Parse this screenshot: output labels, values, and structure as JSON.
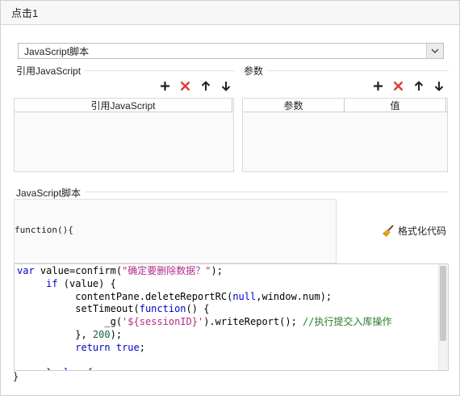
{
  "window": {
    "title": "点击1"
  },
  "script_type_select": {
    "selected": "JavaScript脚本"
  },
  "imports_section": {
    "label": "引用JavaScript",
    "column_header": "引用JavaScript",
    "toolbar": {
      "add": "add-icon",
      "delete": "delete-icon",
      "up": "arrow-up-icon",
      "down": "arrow-down-icon"
    },
    "rows": []
  },
  "params_section": {
    "label": "参数",
    "columns": [
      "参数",
      "值"
    ],
    "toolbar": {
      "add": "add-icon",
      "delete": "delete-icon",
      "up": "arrow-up-icon",
      "down": "arrow-down-icon"
    },
    "rows": []
  },
  "script_section": {
    "label": "JavaScript脚本",
    "function_signature": "function(){",
    "format_button_label": "格式化代码",
    "closing_brace": "}",
    "code_lines": [
      "var value=confirm(\"确定要删除数据？\");",
      "     if (value) {",
      "          contentPane.deleteReportRC(null,window.num);",
      "          setTimeout(function() {",
      "               _g('${sessionID}').writeReport(); //执行提交入库操作",
      "          }, 200);",
      "          return true;",
      "",
      "     } else {"
    ]
  },
  "colors": {
    "keyword": "#0000cc",
    "string": "#b22b8b",
    "comment": "#2a7a2a",
    "delete_icon": "#e03c31"
  }
}
